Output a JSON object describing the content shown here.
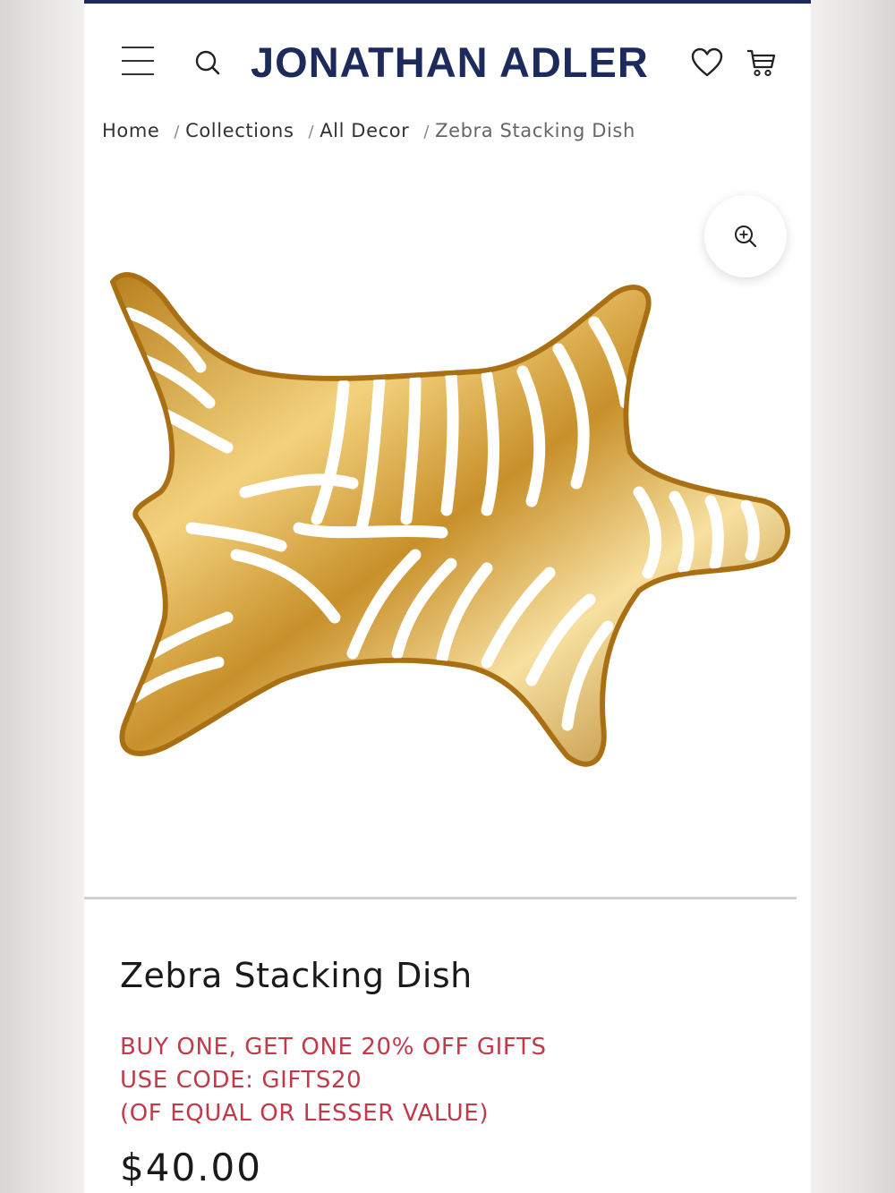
{
  "brand": {
    "logo_text": "JONATHAN ADLER",
    "color": "#1d2a5c"
  },
  "header": {
    "menu_icon": "hamburger-menu-icon",
    "search_icon": "search-icon",
    "wishlist_icon": "heart-icon",
    "cart_icon": "cart-icon"
  },
  "breadcrumb": {
    "items": [
      "Home",
      "Collections",
      "All Decor"
    ],
    "current": "Zebra Stacking Dish",
    "separator": "/"
  },
  "gallery": {
    "zoom_icon": "zoom-in-icon"
  },
  "product": {
    "title": "Zebra Stacking Dish",
    "promo_lines": [
      "BUY ONE, GET ONE 20% OFF GIFTS",
      "USE CODE: GIFTS20",
      "(OF EQUAL OR LESSER VALUE)"
    ],
    "promo_color": "#c23a4a",
    "price": "$40.00"
  }
}
